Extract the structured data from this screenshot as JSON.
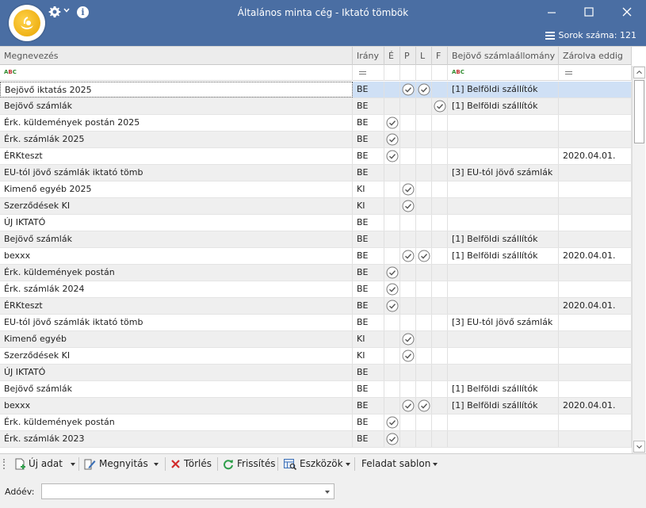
{
  "window": {
    "title": "Általános minta cég - Iktató tömbök",
    "row_count_label": "Sorok száma: 121"
  },
  "columns": [
    {
      "key": "name",
      "label": "Megnevezés"
    },
    {
      "key": "dir",
      "label": "Irány"
    },
    {
      "key": "e",
      "label": "É"
    },
    {
      "key": "p",
      "label": "P"
    },
    {
      "key": "l",
      "label": "L"
    },
    {
      "key": "f",
      "label": "F"
    },
    {
      "key": "ledger",
      "label": "Bejövő számlaállomány"
    },
    {
      "key": "locked",
      "label": "Zárolva eddig"
    }
  ],
  "filter_row": {
    "text_icon": "abc-filter-icon",
    "equals_icon": "equals-filter-icon"
  },
  "rows": [
    {
      "name": "Bejövő iktatás 2025",
      "dir": "BE",
      "e": false,
      "p": true,
      "l": true,
      "f": false,
      "ledger": "[1] Belföldi szállítók",
      "locked": ""
    },
    {
      "name": "Bejövő számlák",
      "dir": "BE",
      "e": false,
      "p": false,
      "l": false,
      "f": true,
      "ledger": "[1] Belföldi szállítók",
      "locked": ""
    },
    {
      "name": "Érk. küldemények postán 2025",
      "dir": "BE",
      "e": true,
      "p": false,
      "l": false,
      "f": false,
      "ledger": "",
      "locked": ""
    },
    {
      "name": "Érk. számlák 2025",
      "dir": "BE",
      "e": true,
      "p": false,
      "l": false,
      "f": false,
      "ledger": "",
      "locked": ""
    },
    {
      "name": "ÉRKteszt",
      "dir": "BE",
      "e": true,
      "p": false,
      "l": false,
      "f": false,
      "ledger": "",
      "locked": "2020.04.01."
    },
    {
      "name": "EU-tól jövő számlák iktató tömb",
      "dir": "BE",
      "e": false,
      "p": false,
      "l": false,
      "f": false,
      "ledger": "[3] EU-tól jövő számlák",
      "locked": ""
    },
    {
      "name": "Kimenő egyéb 2025",
      "dir": "KI",
      "e": false,
      "p": true,
      "l": false,
      "f": false,
      "ledger": "",
      "locked": ""
    },
    {
      "name": "Szerződések KI",
      "dir": "KI",
      "e": false,
      "p": true,
      "l": false,
      "f": false,
      "ledger": "",
      "locked": ""
    },
    {
      "name": "ÚJ IKTATÓ",
      "dir": "BE",
      "e": false,
      "p": false,
      "l": false,
      "f": false,
      "ledger": "",
      "locked": ""
    },
    {
      "name": "Bejövő számlák",
      "dir": "BE",
      "e": false,
      "p": false,
      "l": false,
      "f": false,
      "ledger": "[1] Belföldi szállítók",
      "locked": ""
    },
    {
      "name": "bexxx",
      "dir": "BE",
      "e": false,
      "p": true,
      "l": true,
      "f": false,
      "ledger": "[1] Belföldi szállítók",
      "locked": "2020.04.01."
    },
    {
      "name": "Érk. küldemények postán",
      "dir": "BE",
      "e": true,
      "p": false,
      "l": false,
      "f": false,
      "ledger": "",
      "locked": ""
    },
    {
      "name": "Érk. számlák 2024",
      "dir": "BE",
      "e": true,
      "p": false,
      "l": false,
      "f": false,
      "ledger": "",
      "locked": ""
    },
    {
      "name": "ÉRKteszt",
      "dir": "BE",
      "e": true,
      "p": false,
      "l": false,
      "f": false,
      "ledger": "",
      "locked": "2020.04.01."
    },
    {
      "name": "EU-tól jövő számlák iktató tömb",
      "dir": "BE",
      "e": false,
      "p": false,
      "l": false,
      "f": false,
      "ledger": "[3] EU-tól jövő számlák",
      "locked": ""
    },
    {
      "name": "Kimenő egyéb",
      "dir": "KI",
      "e": false,
      "p": true,
      "l": false,
      "f": false,
      "ledger": "",
      "locked": ""
    },
    {
      "name": "Szerződések KI",
      "dir": "KI",
      "e": false,
      "p": true,
      "l": false,
      "f": false,
      "ledger": "",
      "locked": ""
    },
    {
      "name": "ÚJ IKTATÓ",
      "dir": "BE",
      "e": false,
      "p": false,
      "l": false,
      "f": false,
      "ledger": "",
      "locked": ""
    },
    {
      "name": "Bejövő számlák",
      "dir": "BE",
      "e": false,
      "p": false,
      "l": false,
      "f": false,
      "ledger": "[1] Belföldi szállítók",
      "locked": ""
    },
    {
      "name": "bexxx",
      "dir": "BE",
      "e": false,
      "p": true,
      "l": true,
      "f": false,
      "ledger": "[1] Belföldi szállítók",
      "locked": "2020.04.01."
    },
    {
      "name": "Érk. küldemények postán",
      "dir": "BE",
      "e": true,
      "p": false,
      "l": false,
      "f": false,
      "ledger": "",
      "locked": ""
    },
    {
      "name": "Érk. számlák 2023",
      "dir": "BE",
      "e": true,
      "p": false,
      "l": false,
      "f": false,
      "ledger": "",
      "locked": ""
    }
  ],
  "toolbar": {
    "new_label": "Új adat",
    "open_label": "Megnyitás",
    "delete_label": "Törlés",
    "refresh_label": "Frissítés",
    "tools_label": "Eszközök",
    "template_label": "Feladat sablon"
  },
  "bottom": {
    "adoev_label": "Adóév:",
    "adoev_value": ""
  },
  "colors": {
    "titlebar": "#4a6ea3",
    "selected_row": "#cfe0f5",
    "delete_red": "#d22b2b",
    "refresh_green": "#2e9e4a"
  }
}
